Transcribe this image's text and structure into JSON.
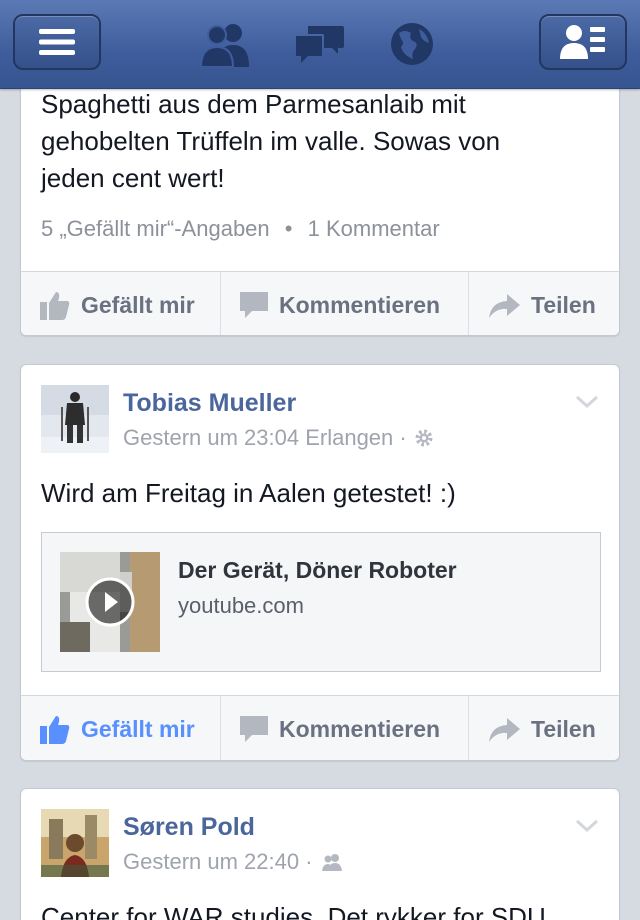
{
  "nav": {
    "menu_icon": "hamburger-menu-icon",
    "friends_icon": "friend-requests-icon",
    "messages_icon": "messages-icon",
    "notifications_icon": "globe-notifications-icon",
    "contacts_icon": "contacts-list-icon"
  },
  "colors": {
    "navbar": "#3f5d9c",
    "link_blue": "#4b669c",
    "liked_blue": "#5890ff",
    "background": "#d6dae1"
  },
  "posts": [
    {
      "text_lines": [
        "Spaghetti aus dem Parmesanlaib mit",
        "gehobelten Trüffeln im valle. Sowas von",
        "jeden cent wert!"
      ],
      "likes": "5 „Gefällt mir“-Angaben",
      "separator": "•",
      "comments": "1 Kommentar",
      "actions": {
        "like": "Gefällt mir",
        "comment": "Kommentieren",
        "share": "Teilen"
      },
      "liked": false
    },
    {
      "author": "Tobias Mueller",
      "time": "Gestern um 23:04 Erlangen ·",
      "privacy_icon": "gear-icon",
      "text": "Wird am Freitag in Aalen getestet! :)",
      "link": {
        "title": "Der Gerät, Döner Roboter",
        "domain": "youtube.com"
      },
      "actions": {
        "like": "Gefällt mir",
        "comment": "Kommentieren",
        "share": "Teilen"
      },
      "liked": true
    },
    {
      "author": "Søren Pold",
      "time": "Gestern um 22:40 ·",
      "privacy_icon": "friends-icon",
      "text": "Center for WAR studies. Det rykker for SDU"
    }
  ]
}
